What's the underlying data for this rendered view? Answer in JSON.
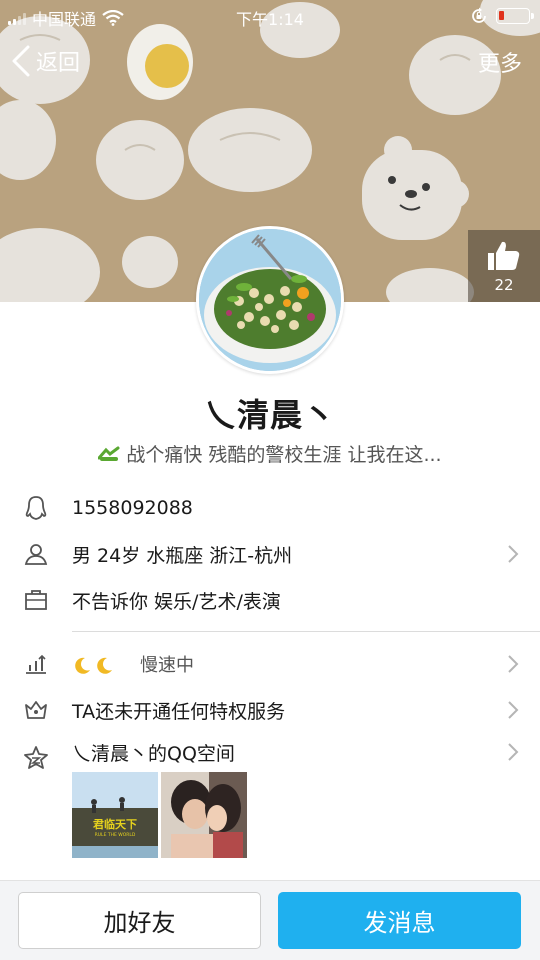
{
  "status_bar": {
    "carrier": "中国联通",
    "time": "下午1:14"
  },
  "nav": {
    "back_label": "返回",
    "more_label": "更多"
  },
  "like": {
    "count": "22"
  },
  "profile": {
    "nickname": "乀清晨丶",
    "signature": "战个痛快 残酷的警校生涯 让我在这..."
  },
  "info": {
    "qq_number": "1558092088",
    "basic": "男 24岁 水瓶座 浙江-杭州",
    "job": "不告诉你 娱乐/艺术/表演",
    "level_speed": "慢速中",
    "vip": "TA还未开通任何特权服务",
    "qzone": "乀清晨丶的QQ空间"
  },
  "qzone_photos": [
    {
      "caption": "君临天下",
      "subcaption": "RULE THE WORLD"
    },
    {
      "caption": ""
    }
  ],
  "actions": {
    "add_friend": "加好友",
    "send_message": "发消息"
  },
  "colors": {
    "cover_bg": "#b9a27f",
    "accent_blue": "#1fb0ef",
    "battery_low": "#e0321c"
  }
}
